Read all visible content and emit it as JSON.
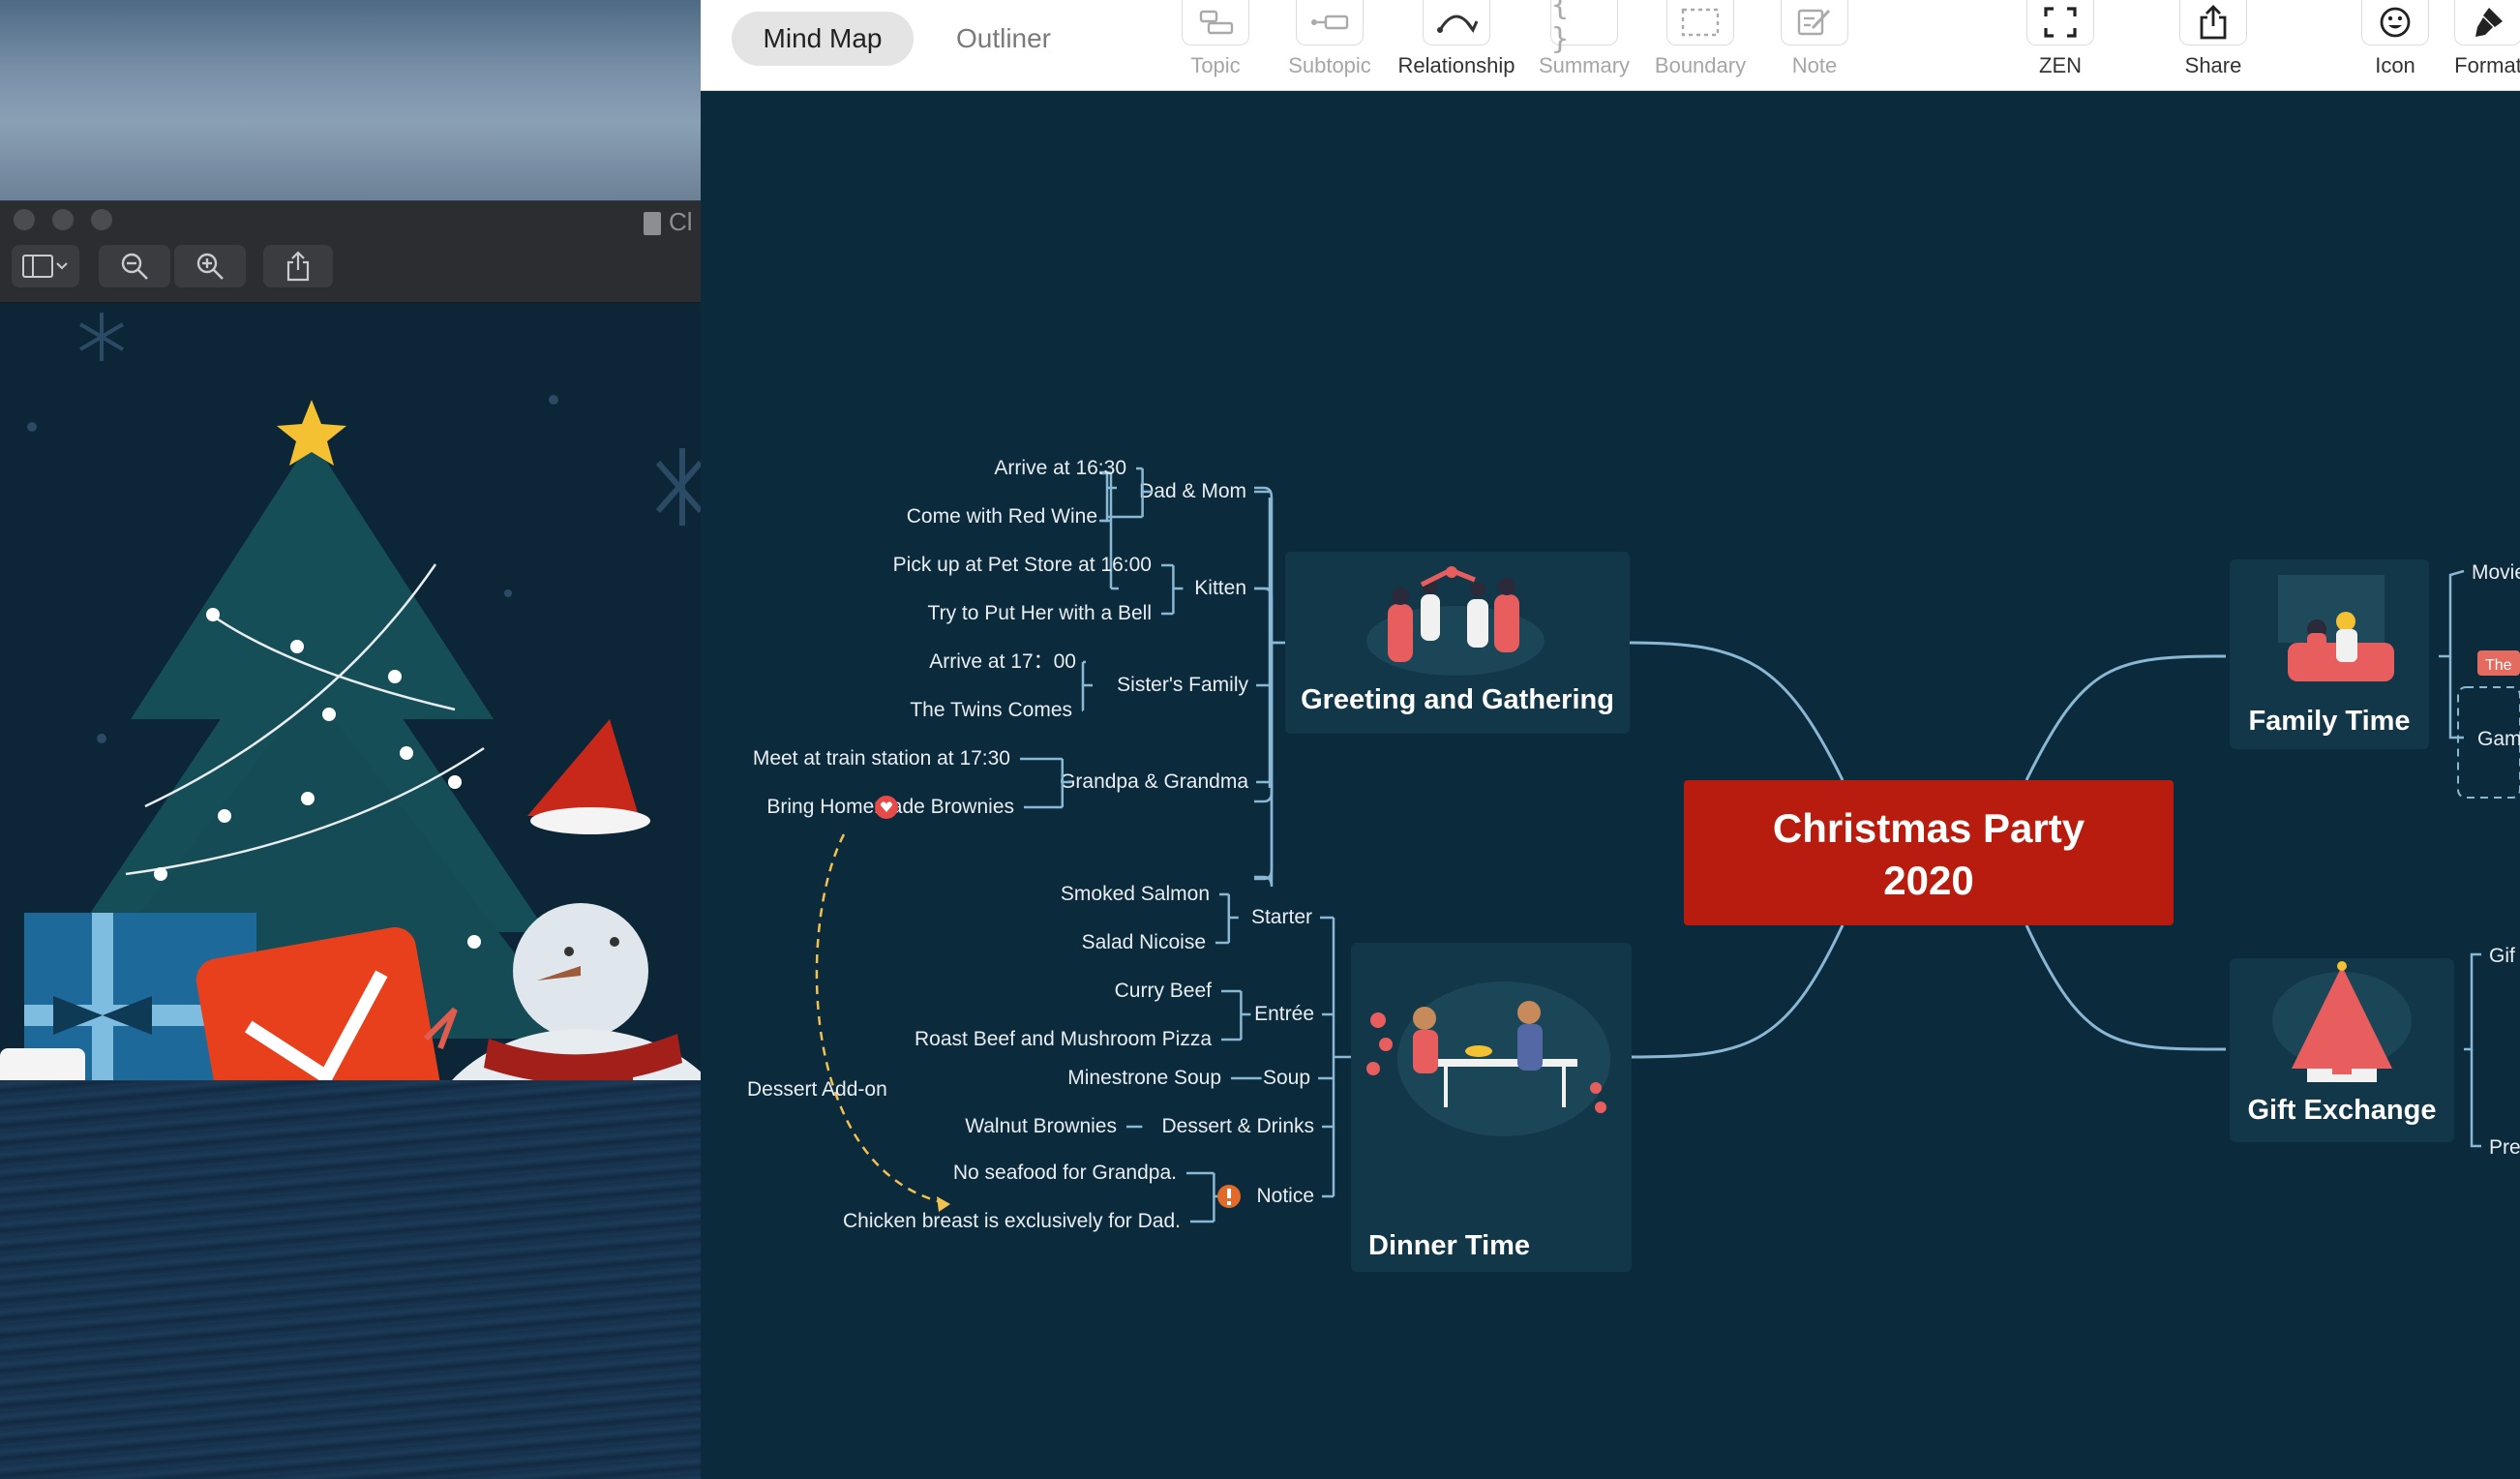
{
  "preview": {
    "title": "Cl"
  },
  "toolbar": {
    "tabs": [
      {
        "label": "Mind Map",
        "active": true
      },
      {
        "label": "Outliner",
        "active": false
      }
    ],
    "tools": [
      {
        "label": "Topic",
        "icon": "topic-icon"
      },
      {
        "label": "Subtopic",
        "icon": "subtopic-icon"
      },
      {
        "label": "Relationship",
        "icon": "relationship-icon"
      },
      {
        "label": "Summary",
        "icon": "summary-icon"
      },
      {
        "label": "Boundary",
        "icon": "boundary-icon"
      },
      {
        "label": "Note",
        "icon": "note-icon"
      }
    ],
    "zen_label": "ZEN",
    "share_label": "Share",
    "icon_label": "Icon",
    "format_label": "Format"
  },
  "colors": {
    "canvas": "#0b2a3c",
    "central_topic": "#b81c0e",
    "branch_card": "#123748",
    "line": "#8ab8d4",
    "relationship": "#f2c14e",
    "label_tag": "#e36b5f"
  },
  "mindmap": {
    "central": {
      "line1": "Christmas Party",
      "line2": "2020"
    },
    "branches": {
      "greeting": {
        "title": "Greeting and Gathering",
        "groups": [
          {
            "label": "Dad & Mom",
            "items": [
              "Arrive at 16:30",
              "Come with Red Wine"
            ]
          },
          {
            "label": "Kitten",
            "items": [
              "Pick up at Pet Store at 16:00",
              "Try to Put Her with a Bell"
            ]
          },
          {
            "label": "Sister's Family",
            "items": [
              "Arrive at 17：00",
              "The Twins Comes"
            ]
          },
          {
            "label": "Grandpa & Grandma",
            "items": [
              "Meet at train station at 17:30",
              "Bring Homemade Brownies"
            ]
          }
        ]
      },
      "dinner": {
        "title": "Dinner Time",
        "groups": [
          {
            "label": "Starter",
            "items": [
              "Smoked Salmon",
              "Salad Nicoise"
            ]
          },
          {
            "label": "Entrée",
            "items": [
              "Curry Beef",
              "Roast Beef and Mushroom Pizza"
            ]
          },
          {
            "label": "Soup",
            "items": [
              "Minestrone Soup"
            ]
          },
          {
            "label": "Dessert & Drinks",
            "items": [
              "Walnut Brownies"
            ]
          },
          {
            "label": "Notice",
            "items": [
              "No seafood for Grandpa.",
              "Chicken breast is exclusively for Dad."
            ]
          }
        ]
      },
      "family": {
        "title": "Family Time",
        "children": [
          "Movie",
          "Gam"
        ],
        "tag": "The"
      },
      "gift": {
        "title": "Gift Exchange",
        "children": [
          "Gif",
          "Pre"
        ]
      }
    },
    "relationship_label": "Dessert Add-on"
  }
}
